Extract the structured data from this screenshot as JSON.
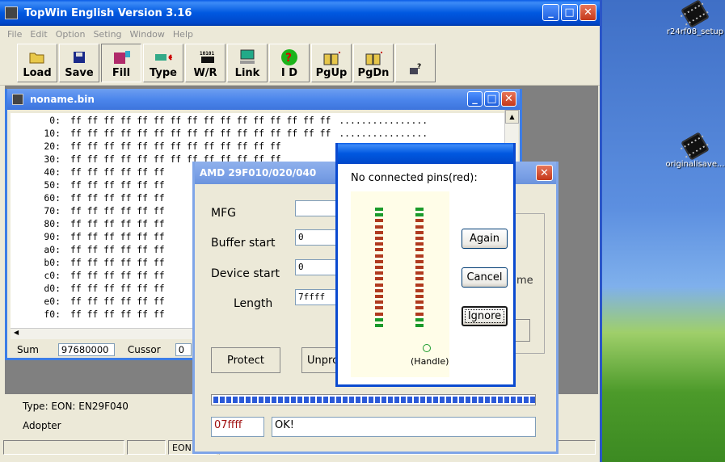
{
  "desktop": {
    "icons": [
      {
        "label": "r24rf08_setup"
      },
      {
        "label": "originalisave..."
      }
    ]
  },
  "main": {
    "title": "TopWin  English Version 3.16",
    "menu": [
      "File",
      "Edit",
      "Option",
      "Seting",
      "Window",
      "Help"
    ],
    "toolbar": [
      {
        "label": "Load",
        "icon": "folder-open-icon"
      },
      {
        "label": "Save",
        "icon": "floppy-disk-icon"
      },
      {
        "label": "Fill",
        "icon": "fill-icon"
      },
      {
        "label": "Type",
        "icon": "chip-type-icon"
      },
      {
        "label": "W/R",
        "icon": "write-read-icon"
      },
      {
        "label": "Link",
        "icon": "computer-link-icon"
      },
      {
        "label": "I D",
        "icon": "question-id-icon"
      },
      {
        "label": "PgUp",
        "icon": "page-up-icon"
      },
      {
        "label": "PgDn",
        "icon": "page-down-icon"
      },
      {
        "label": "",
        "icon": "key-icon"
      }
    ],
    "type_text": "Type:  EON: EN29F040",
    "adopter_text": "Adopter",
    "status": [
      "",
      "",
      "EON",
      ""
    ]
  },
  "hex": {
    "title": "noname.bin",
    "rows": [
      {
        "addr": "0:",
        "bytes": "ff ff ff ff ff ff ff ff ff ff ff ff ff ff ff ff",
        "ascii": "................"
      },
      {
        "addr": "10:",
        "bytes": "ff ff ff ff ff ff ff ff ff ff ff ff ff ff ff ff",
        "ascii": "................"
      },
      {
        "addr": "20:",
        "bytes": "ff ff ff ff ff ff ff ff ff ff ff ff ff",
        "ascii": ""
      },
      {
        "addr": "30:",
        "bytes": "ff ff ff ff ff ff ff ff ff ff ff ff ff",
        "ascii": ""
      },
      {
        "addr": "40:",
        "bytes": "ff ff ff ff ff ff",
        "ascii": ""
      },
      {
        "addr": "50:",
        "bytes": "ff ff ff ff ff ff",
        "ascii": ""
      },
      {
        "addr": "60:",
        "bytes": "ff ff ff ff ff ff",
        "ascii": ""
      },
      {
        "addr": "70:",
        "bytes": "ff ff ff ff ff ff",
        "ascii": ""
      },
      {
        "addr": "80:",
        "bytes": "ff ff ff ff ff ff",
        "ascii": ""
      },
      {
        "addr": "90:",
        "bytes": "ff ff ff ff ff ff",
        "ascii": ""
      },
      {
        "addr": "a0:",
        "bytes": "ff ff ff ff ff ff",
        "ascii": ""
      },
      {
        "addr": "b0:",
        "bytes": "ff ff ff ff ff ff",
        "ascii": ""
      },
      {
        "addr": "c0:",
        "bytes": "ff ff ff ff ff ff",
        "ascii": ""
      },
      {
        "addr": "d0:",
        "bytes": "ff ff ff ff ff ff",
        "ascii": ""
      },
      {
        "addr": "e0:",
        "bytes": "ff ff ff ff ff ff",
        "ascii": ""
      },
      {
        "addr": "f0:",
        "bytes": "ff ff ff ff ff ff",
        "ascii": ""
      }
    ],
    "sum_label": "Sum",
    "sum_value": "97680000",
    "cursor_label": "Cussor",
    "cursor_value": "0"
  },
  "amd": {
    "title": "AMD 29F010/020/040",
    "mfg_label": "MFG",
    "mfg_value": "",
    "buffer_label": "Buffer start",
    "buffer_value": "0",
    "device_label": "Device start",
    "device_value": "0",
    "length_label": "Length",
    "length_value": "7ffff",
    "protect_label": "Protect",
    "unprotect_label": "Unpro",
    "side_fragment": "me",
    "address_value": "07ffff",
    "status_value": "OK!",
    "progress": 1.0
  },
  "pins": {
    "heading": "No connected pins(red):",
    "handle_label": "(Handle)",
    "again_label": "Again",
    "cancel_label": "Cancel",
    "ignore_label": "Ignore",
    "colors": {
      "ok": "#1a9a2a",
      "bad": "#b03a1e"
    },
    "left_column": [
      "g",
      "g",
      "b",
      "b",
      "b",
      "b",
      "b",
      "b",
      "b",
      "b",
      "b",
      "b",
      "b",
      "b",
      "b",
      "b",
      "b",
      "b",
      "b",
      "g",
      "g"
    ],
    "right_column": [
      "g",
      "g",
      "b",
      "b",
      "b",
      "b",
      "b",
      "b",
      "b",
      "b",
      "b",
      "b",
      "b",
      "b",
      "b",
      "b",
      "b",
      "b",
      "b",
      "g",
      "g"
    ]
  }
}
